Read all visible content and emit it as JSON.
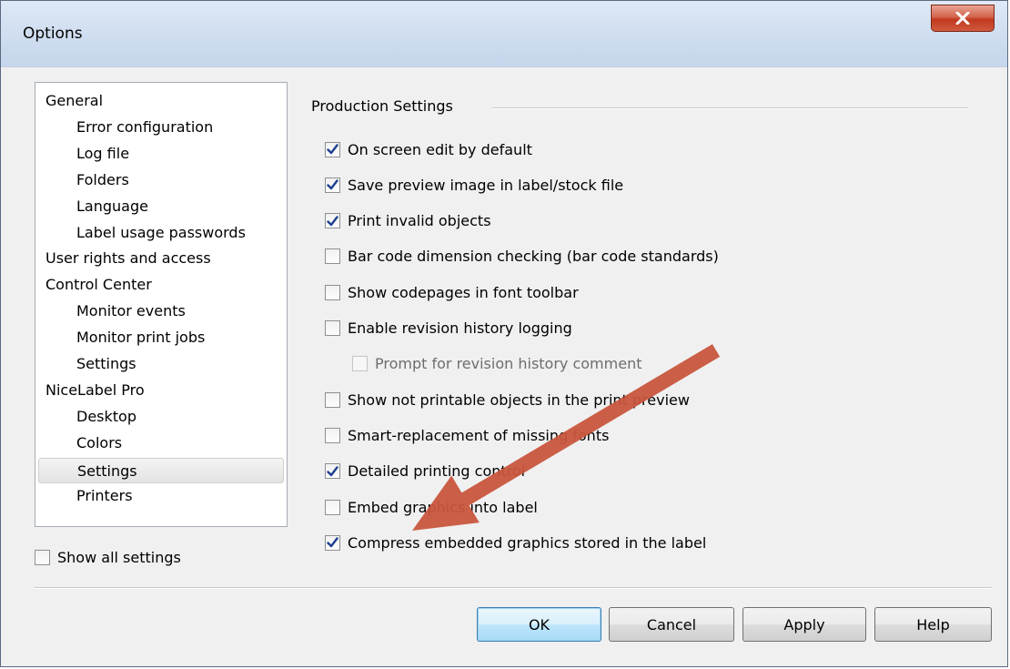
{
  "window": {
    "title": "Options",
    "close_glyph": "X"
  },
  "nav": {
    "items": [
      {
        "label": "General",
        "level": 0,
        "selected": false
      },
      {
        "label": "Error configuration",
        "level": 1,
        "selected": false
      },
      {
        "label": "Log file",
        "level": 1,
        "selected": false
      },
      {
        "label": "Folders",
        "level": 1,
        "selected": false
      },
      {
        "label": "Language",
        "level": 1,
        "selected": false
      },
      {
        "label": "Label usage passwords",
        "level": 1,
        "selected": false
      },
      {
        "label": "User rights and access",
        "level": 0,
        "selected": false
      },
      {
        "label": "Control Center",
        "level": 0,
        "selected": false
      },
      {
        "label": "Monitor events",
        "level": 1,
        "selected": false
      },
      {
        "label": "Monitor print jobs",
        "level": 1,
        "selected": false
      },
      {
        "label": "Settings",
        "level": 1,
        "selected": false
      },
      {
        "label": "NiceLabel Pro",
        "level": 0,
        "selected": false
      },
      {
        "label": "Desktop",
        "level": 1,
        "selected": false
      },
      {
        "label": "Colors",
        "level": 1,
        "selected": false
      },
      {
        "label": "Settings",
        "level": 1,
        "selected": true
      },
      {
        "label": "Printers",
        "level": 1,
        "selected": false
      }
    ]
  },
  "show_all": {
    "label": "Show all settings",
    "checked": false
  },
  "production": {
    "title": "Production Settings",
    "settings": [
      {
        "label": "On screen edit by default",
        "checked": true,
        "enabled": true,
        "indent": false
      },
      {
        "label": "Save preview image in label/stock file",
        "checked": true,
        "enabled": true,
        "indent": false
      },
      {
        "label": "Print invalid objects",
        "checked": true,
        "enabled": true,
        "indent": false
      },
      {
        "label": "Bar code dimension checking (bar code standards)",
        "checked": false,
        "enabled": true,
        "indent": false
      },
      {
        "label": "Show codepages in font toolbar",
        "checked": false,
        "enabled": true,
        "indent": false
      },
      {
        "label": "Enable revision history logging",
        "checked": false,
        "enabled": true,
        "indent": false
      },
      {
        "label": "Prompt for revision history comment",
        "checked": false,
        "enabled": false,
        "indent": true
      },
      {
        "label": "Show not printable objects in the print preview",
        "checked": false,
        "enabled": true,
        "indent": false
      },
      {
        "label": "Smart-replacement of missing fonts",
        "checked": false,
        "enabled": true,
        "indent": false
      },
      {
        "label": "Detailed printing control",
        "checked": true,
        "enabled": true,
        "indent": false
      },
      {
        "label": "Embed graphics into label",
        "checked": false,
        "enabled": true,
        "indent": false
      },
      {
        "label": "Compress embedded graphics stored in the label",
        "checked": true,
        "enabled": true,
        "indent": false
      }
    ]
  },
  "buttons": {
    "ok": "OK",
    "cancel": "Cancel",
    "apply": "Apply",
    "help": "Help"
  },
  "colors": {
    "arrow": "#c8553d",
    "check": "#1f3f8f",
    "close": "#c2391e"
  }
}
